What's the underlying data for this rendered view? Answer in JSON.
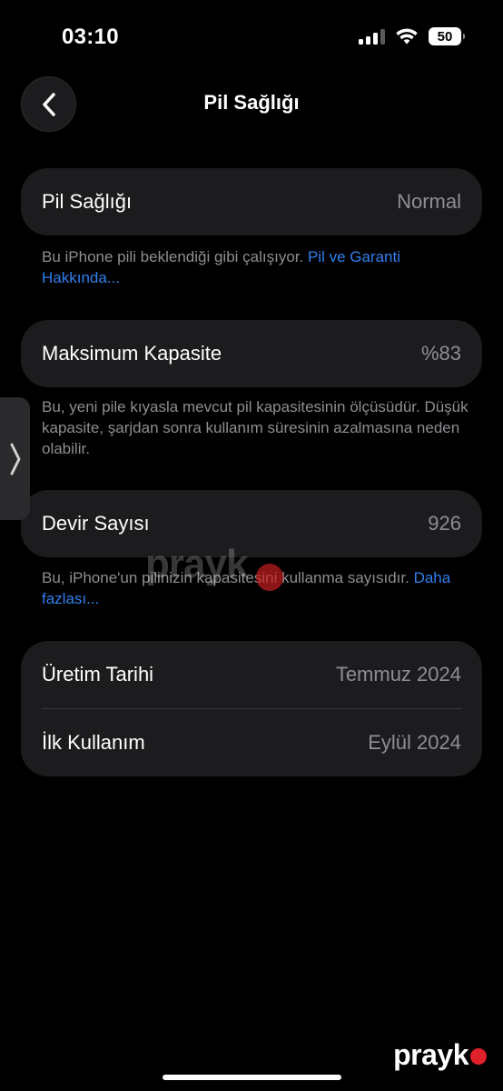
{
  "status_bar": {
    "time": "03:10",
    "battery_level": "50",
    "icons": [
      "cellular-signal-icon",
      "wifi-icon",
      "battery-icon"
    ]
  },
  "header": {
    "title": "Pil Sağlığı",
    "back_icon": "chevron-left-icon"
  },
  "battery_health": {
    "label": "Pil Sağlığı",
    "value": "Normal",
    "note": "Bu iPhone pili beklendiği gibi çalışıyor. ",
    "note_link": "Pil ve Garanti Hakkında..."
  },
  "max_capacity": {
    "label": "Maksimum Kapasite",
    "value": "%83",
    "note": "Bu, yeni pile kıyasla mevcut pil kapasitesinin ölçüsüdür. Düşük kapasite, şarjdan sonra kullanım süresinin azalmasına neden olabilir."
  },
  "cycle_count": {
    "label": "Devir Sayısı",
    "value": "926",
    "note": "Bu, iPhone'un pilinizin kapasitesini kullanma sayısıdır. ",
    "note_link": "Daha fazlası..."
  },
  "dates": {
    "manufacture_label": "Üretim Tarihi",
    "manufacture_value": "Temmuz 2024",
    "first_use_label": "İlk Kullanım",
    "first_use_value": "Eylül 2024"
  },
  "side_tab": {
    "icon": "chevron-right-icon"
  },
  "watermark": {
    "text": "prayk"
  },
  "colors": {
    "background": "#000000",
    "card": "#1c1c1e",
    "secondary_text": "#8e8e93",
    "link": "#2f80ed",
    "watermark_dot": "#e0202a"
  }
}
